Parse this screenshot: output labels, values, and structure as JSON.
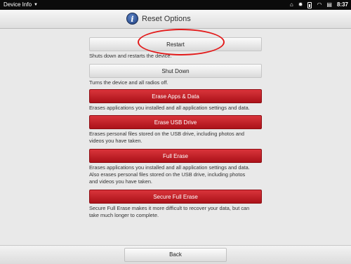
{
  "status_bar": {
    "app_name": "Device Info",
    "time": "8:37"
  },
  "header": {
    "title": "Reset Options",
    "icon": "info-icon"
  },
  "options": [
    {
      "label": "Restart",
      "style": "gray",
      "description": [
        "Shuts down and restarts the device."
      ]
    },
    {
      "label": "Shut Down",
      "style": "gray",
      "description": [
        "Turns the device and all radios off."
      ]
    },
    {
      "label": "Erase Apps & Data",
      "style": "red",
      "description": [
        "Erases applications you installed and all application settings and data."
      ]
    },
    {
      "label": "Erase USB Drive",
      "style": "red",
      "description": [
        "Erases personal files stored on the USB drive, including photos and",
        "videos you have taken."
      ]
    },
    {
      "label": "Full Erase",
      "style": "red",
      "description": [
        "Erases applications you installed and all application settings and data.",
        "Also erases personal files stored on the USB drive, including photos",
        "and videos you have taken."
      ]
    },
    {
      "label": "Secure Full Erase",
      "style": "red",
      "description": [
        "Secure Full Erase makes it more difficult to recover your data, but can",
        "take much longer to complete."
      ]
    }
  ],
  "footer": {
    "back_label": "Back"
  },
  "colors": {
    "red_button": "#c0202a",
    "annotation_circle": "#e31b1b"
  }
}
